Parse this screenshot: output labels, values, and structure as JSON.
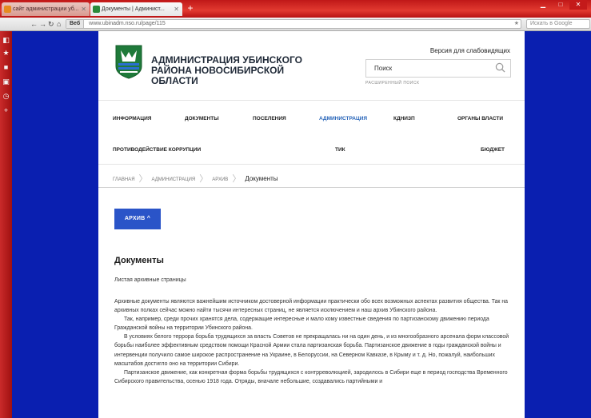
{
  "browser": {
    "tabs": [
      {
        "title": "сайт администрации уб..."
      },
      {
        "title": "Документы | Админист..."
      }
    ],
    "address": "www.ubinadm.nso.ru/page/115",
    "web_label": "Веб",
    "search_placeholder": "Искать в Google"
  },
  "site": {
    "name": "АДМИНИСТРАЦИЯ УБИНСКОГО РАЙОНА НОВОСИБИРСКОЙ ОБЛАСТИ",
    "vision_version": "Версия для слабовидящих",
    "search_placeholder": "Поиск",
    "advanced_search": "РАСШИРЕННЫЙ ПОИСК"
  },
  "menu": {
    "row1": [
      "ИНФОРМАЦИЯ",
      "ДОКУМЕНТЫ",
      "ПОСЕЛЕНИЯ",
      "АДМИНИСТРАЦИЯ",
      "КДНИЗП",
      "ОРГАНЫ ВЛАСТИ"
    ],
    "row2": [
      "ПРОТИВОДЕЙСТВИЕ КОРРУПЦИИ",
      "ТИК",
      "БЮДЖЕТ"
    ],
    "active": "АДМИНИСТРАЦИЯ"
  },
  "breadcrumbs": [
    "ГЛАВНАЯ",
    "АДМИНИСТРАЦИЯ",
    "АРХИВ",
    "Документы"
  ],
  "archive_button": "АРХИВ ^",
  "content": {
    "title": "Документы",
    "subtitle": "Листая архивные страницы",
    "paragraphs": [
      "Архивные документы являются важнейшим источником достоверной информации практически обо всех возможных аспектах развития общества. Так на архивных полках сейчас можно найти тысячи интересных страниц, не является исключением и наш архив Убинского района.",
      "Так, например, среди прочих хранятся дела, содержащие интересные и мало кому известные сведения по партизанскому движению периода Гражданской войны на территории Убинского района.",
      "В условиях белого террора борьба трудящихся за власть Советов не прекращалась ни на один день, и из многообразного арсенала форм классовой борьбы наиболее эффективным средством помощи Красной Армии стала партизанская борьба. Партизанское движение в годы гражданской войны и интервенции получило самое широкое распространение на Украине, в Белоруссии, на Северном Кавказе, в Крыму и т. д. Но, пожалуй, наибольших масштабов достигло оно на территории Сибири.",
      "Партизанское движение, как конкретная форма борьбы трудящихся с контрреволюцией, зародилось в Сибири еще в период господства Временного Сибирского правительства, осенью 1918 года. Отряды, вначале небольшие, создавались партийными и"
    ]
  },
  "colors": {
    "desktop": "#0a1fb0",
    "tabbar": "#d42a22",
    "accent": "#2a54c8",
    "active_menu": "#2563b8"
  }
}
